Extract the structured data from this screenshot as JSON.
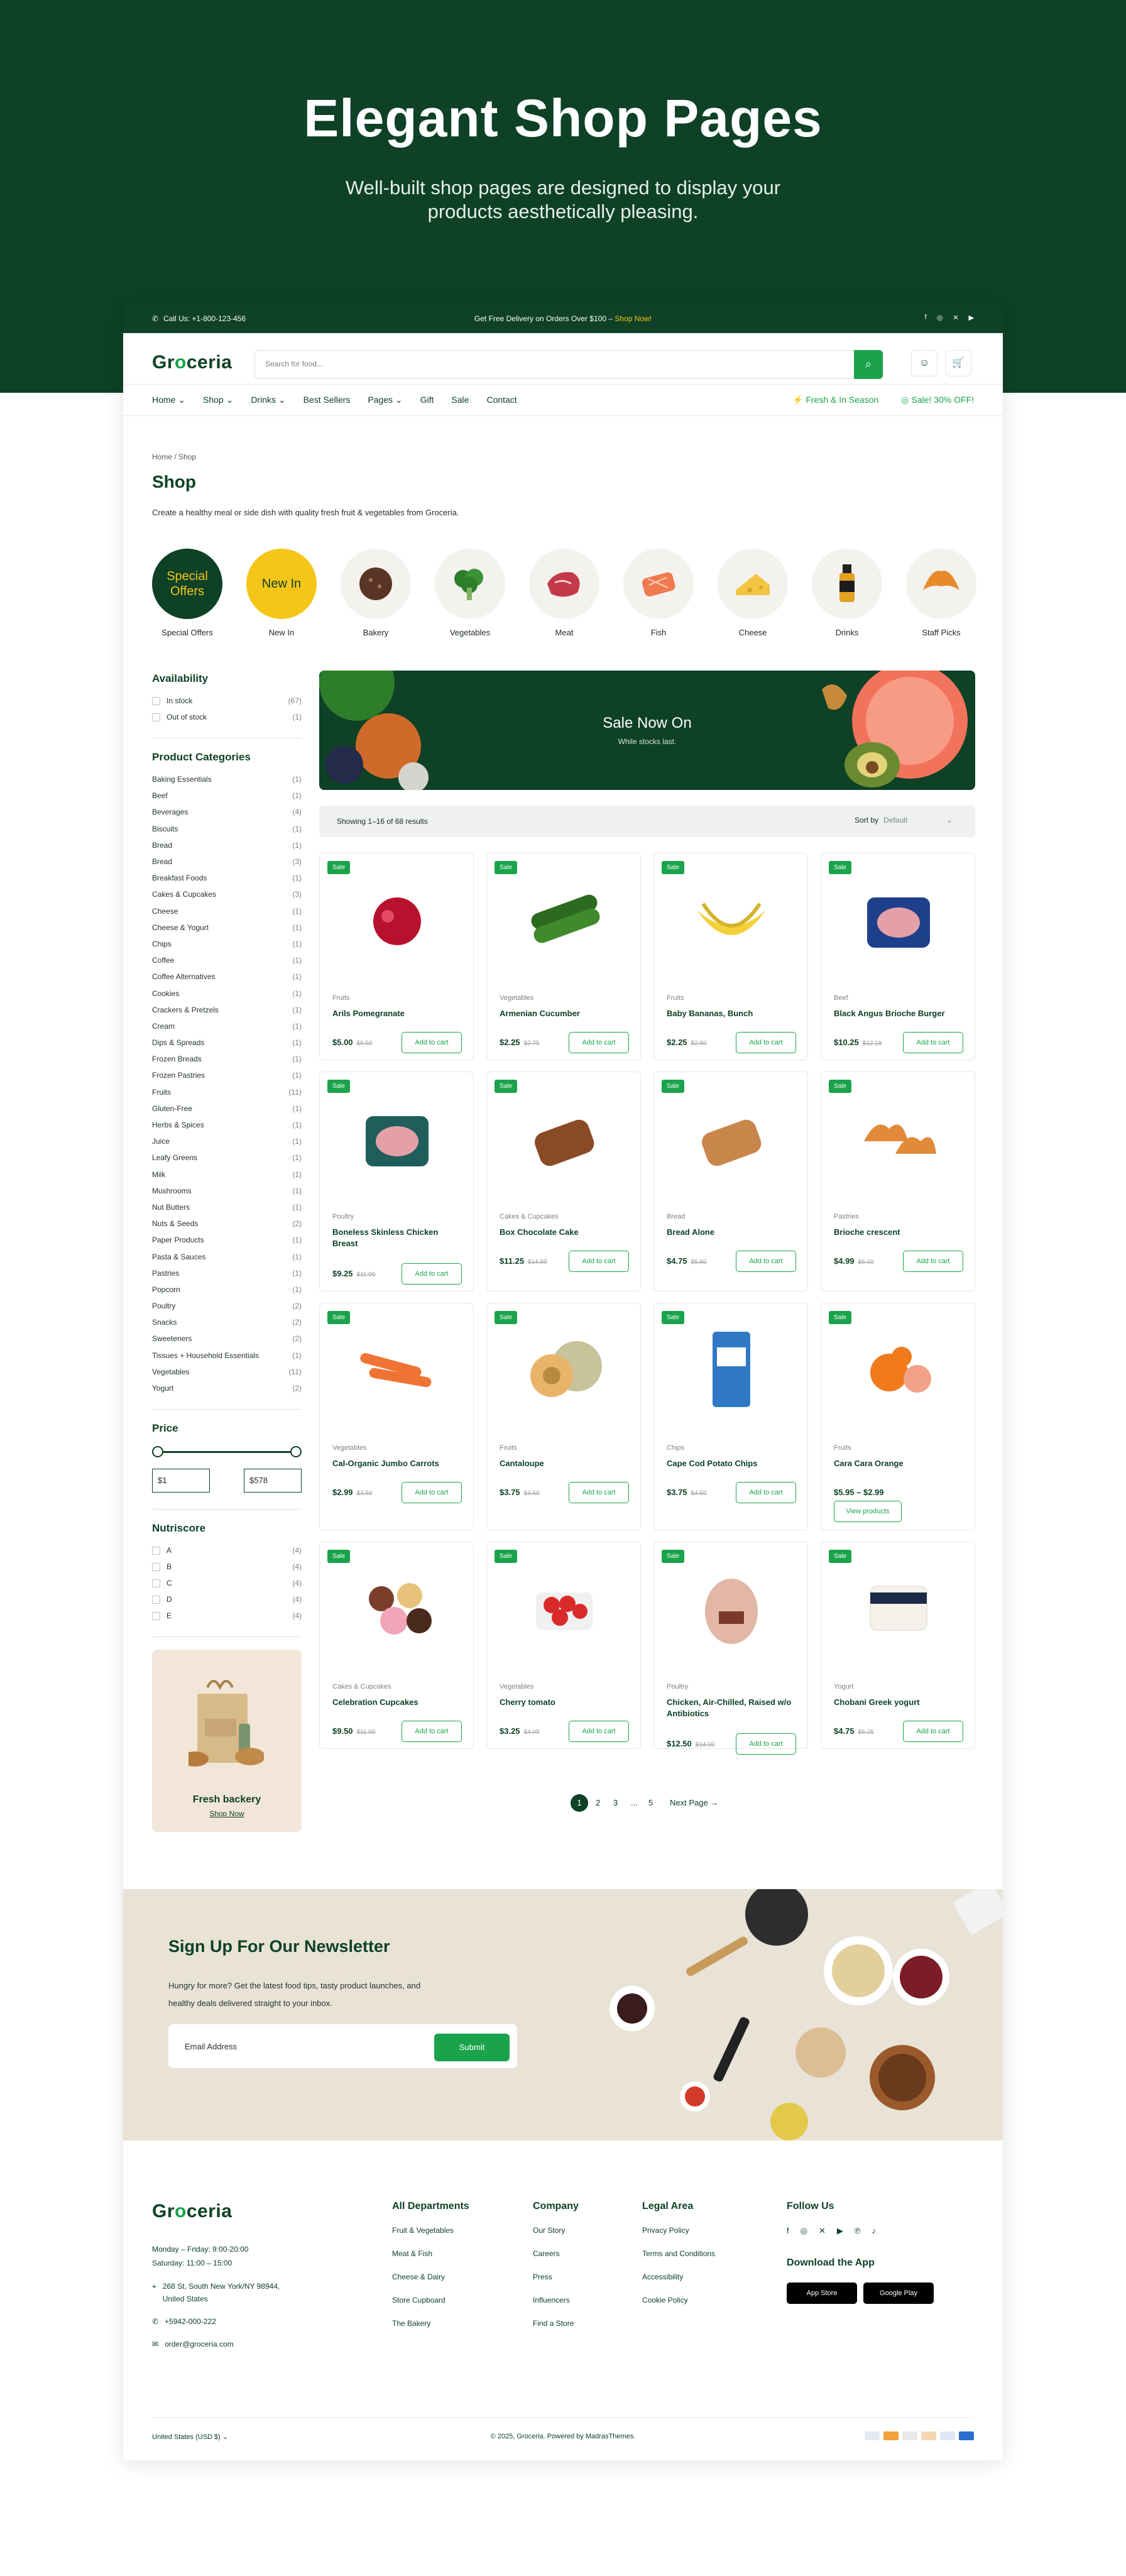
{
  "hero": {
    "title": "Elegant Shop Pages",
    "subtitle": "Well-built shop pages are designed to display your products aesthetically pleasing."
  },
  "topbar": {
    "phone": "Call Us: +1-800-123-456",
    "promo": "Get Free Delivery on Orders Over $100 – ",
    "promo_link": "Shop Now!",
    "socials": [
      "facebook-icon",
      "instagram-icon",
      "x-icon",
      "youtube-icon"
    ]
  },
  "header": {
    "logo_a": "Gr",
    "logo_b": "o",
    "logo_c": "ceria",
    "search_placeholder": "Search for food..."
  },
  "nav": {
    "items": [
      "Home",
      "Shop",
      "Drinks",
      "Best Sellers",
      "Pages",
      "Gift",
      "Sale",
      "Contact"
    ],
    "right1": "Fresh & In Season",
    "right2": "Sale! 30% OFF!"
  },
  "breadcrumb": "Home / Shop",
  "page_title": "Shop",
  "page_desc": "Create a healthy meal or side dish with quality fresh fruit & vegetables from Groceria.",
  "categories": [
    "Special Offers",
    "New In",
    "Bakery",
    "Vegetables",
    "Meat",
    "Fish",
    "Cheese",
    "Drinks",
    "Staff Picks"
  ],
  "category_badges": {
    "special": "Special Offers",
    "new": "New In"
  },
  "availability": {
    "title": "Availability",
    "items": [
      {
        "label": "In stock",
        "count": "(67)"
      },
      {
        "label": "Out of stock",
        "count": "(1)"
      }
    ]
  },
  "product_categories": {
    "title": "Product Categories",
    "items": [
      {
        "label": "Baking Essentials",
        "count": "(1)"
      },
      {
        "label": "Beef",
        "count": "(1)"
      },
      {
        "label": "Beverages",
        "count": "(4)"
      },
      {
        "label": "Biscuits",
        "count": "(1)"
      },
      {
        "label": "Bread",
        "count": "(1)"
      },
      {
        "label": "Bread",
        "count": "(3)"
      },
      {
        "label": "Breakfast Foods",
        "count": "(1)"
      },
      {
        "label": "Cakes & Cupcakes",
        "count": "(3)"
      },
      {
        "label": "Cheese",
        "count": "(1)"
      },
      {
        "label": "Cheese & Yogurt",
        "count": "(1)"
      },
      {
        "label": "Chips",
        "count": "(1)"
      },
      {
        "label": "Coffee",
        "count": "(1)"
      },
      {
        "label": "Coffee Alternatives",
        "count": "(1)"
      },
      {
        "label": "Cookies",
        "count": "(1)"
      },
      {
        "label": "Crackers & Pretzels",
        "count": "(1)"
      },
      {
        "label": "Cream",
        "count": "(1)"
      },
      {
        "label": "Dips & Spreads",
        "count": "(1)"
      },
      {
        "label": "Frozen Breads",
        "count": "(1)"
      },
      {
        "label": "Frozen Pastries",
        "count": "(1)"
      },
      {
        "label": "Fruits",
        "count": "(11)"
      },
      {
        "label": "Gluten-Free",
        "count": "(1)"
      },
      {
        "label": "Herbs & Spices",
        "count": "(1)"
      },
      {
        "label": "Juice",
        "count": "(1)"
      },
      {
        "label": "Leafy Greens",
        "count": "(1)"
      },
      {
        "label": "Milk",
        "count": "(1)"
      },
      {
        "label": "Mushrooms",
        "count": "(1)"
      },
      {
        "label": "Nut Butters",
        "count": "(1)"
      },
      {
        "label": "Nuts & Seeds",
        "count": "(2)"
      },
      {
        "label": "Paper Products",
        "count": "(1)"
      },
      {
        "label": "Pasta & Sauces",
        "count": "(1)"
      },
      {
        "label": "Pastries",
        "count": "(1)"
      },
      {
        "label": "Popcorn",
        "count": "(1)"
      },
      {
        "label": "Poultry",
        "count": "(2)"
      },
      {
        "label": "Snacks",
        "count": "(2)"
      },
      {
        "label": "Sweeteners",
        "count": "(2)"
      },
      {
        "label": "Tissues + Household Essentials",
        "count": "(1)"
      },
      {
        "label": "Vegetables",
        "count": "(11)"
      },
      {
        "label": "Yogurt",
        "count": "(2)"
      }
    ]
  },
  "price": {
    "title": "Price",
    "min": "$1",
    "max": "$578"
  },
  "nutriscore": {
    "title": "Nutriscore",
    "items": [
      {
        "label": "A",
        "count": "(4)"
      },
      {
        "label": "B",
        "count": "(4)"
      },
      {
        "label": "C",
        "count": "(4)"
      },
      {
        "label": "D",
        "count": "(4)"
      },
      {
        "label": "E",
        "count": "(4)"
      }
    ]
  },
  "promo": {
    "title": "Fresh backery",
    "link": "Shop Now"
  },
  "banner": {
    "title": "Sale Now On",
    "subtitle": "While stocks last."
  },
  "sort": {
    "showing": "Showing 1–16 of 68 results",
    "label": "Sort by",
    "value": "Default"
  },
  "products": [
    {
      "cat": "Fruits",
      "name": "Arils Pomegranate",
      "price": "$5.00",
      "old": "$6.50",
      "btn": "Add to cart",
      "color": "#b8112e"
    },
    {
      "cat": "Vegetables",
      "name": "Armenian Cucumber",
      "price": "$2.25",
      "old": "$2.75",
      "btn": "Add to cart",
      "color": "#2d6a1f"
    },
    {
      "cat": "Fruits",
      "name": "Baby Bananas, Bunch",
      "price": "$2.25",
      "old": "$2.50",
      "btn": "Add to cart",
      "color": "#f3d13b"
    },
    {
      "cat": "Beef",
      "name": "Black Angus Brioche Burger",
      "price": "$10.25",
      "old": "$12.18",
      "btn": "Add to cart",
      "color": "#1e3f8a"
    },
    {
      "cat": "Poultry",
      "name": "Boneless Skinless Chicken Breast",
      "price": "$9.25",
      "old": "$11.00",
      "btn": "Add to cart",
      "color": "#1f5e5a"
    },
    {
      "cat": "Cakes & Cupcakes",
      "name": "Box Chocolate Cake",
      "price": "$11.25",
      "old": "$14.50",
      "btn": "Add to cart",
      "color": "#8a4a25"
    },
    {
      "cat": "Bread",
      "name": "Bread Alone",
      "price": "$4.75",
      "old": "$5.50",
      "btn": "Add to cart",
      "color": "#c9864a"
    },
    {
      "cat": "Pastries",
      "name": "Brioche crescent",
      "price": "$4.99",
      "old": "$6.00",
      "btn": "Add to cart",
      "color": "#e08a3a"
    },
    {
      "cat": "Vegetables",
      "name": "Cal-Organic Jumbo Carrots",
      "price": "$2.99",
      "old": "$3.50",
      "btn": "Add to cart",
      "color": "#ef7433"
    },
    {
      "cat": "Fruits",
      "name": "Cantaloupe",
      "price": "$3.75",
      "old": "$4.50",
      "btn": "Add to cart",
      "color": "#e8b46a"
    },
    {
      "cat": "Chips",
      "name": "Cape Cod Potato Chips",
      "price": "$3.75",
      "old": "$4.50",
      "btn": "Add to cart",
      "color": "#2f78c4"
    },
    {
      "cat": "Fruits",
      "name": "Cara Cara Orange",
      "price": "$5.95 – $2.99",
      "old": "",
      "btn": "View products",
      "color": "#f07a1c"
    },
    {
      "cat": "Cakes & Cupcakes",
      "name": "Celebration Cupcakes",
      "price": "$9.50",
      "old": "$11.00",
      "btn": "Add to cart",
      "color": "#7a3f2a"
    },
    {
      "cat": "Vegetables",
      "name": "Cherry tomato",
      "price": "$3.25",
      "old": "$4.00",
      "btn": "Add to cart",
      "color": "#d92a2a"
    },
    {
      "cat": "Poultry",
      "name": "Chicken, Air-Chilled, Raised w/o Antibiotics",
      "price": "$12.50",
      "old": "$14.00",
      "btn": "Add to cart",
      "color": "#e2b7a6"
    },
    {
      "cat": "Yogurt",
      "name": "Chobani Greek yogurt",
      "price": "$4.75",
      "old": "$6.25",
      "btn": "Add to cart",
      "color": "#f3f1ea"
    }
  ],
  "sale_badge": "Sale",
  "pagination": {
    "pages": [
      "1",
      "2",
      "3",
      "...",
      "5"
    ],
    "next": "Next Page"
  },
  "newsletter": {
    "title": "Sign Up For Our Newsletter",
    "text": "Hungry for more? Get the latest food tips, tasty product launches, and healthy deals delivered straight to your inbox.",
    "placeholder": "Email Address",
    "button": "Submit"
  },
  "footer": {
    "hours1": "Monday – Friday: 9:00-20:00",
    "hours2": "Saturday: 11:00 – 15:00",
    "address": "268 St, South New York/NY 98944, United States",
    "phone": "+5942-000-222",
    "email": "order@groceria.com",
    "departments": {
      "title": "All Departments",
      "items": [
        "Fruit & Vegetables",
        "Meat & Fish",
        "Cheese & Dairy",
        "Store Cupboard",
        "The Bakery"
      ]
    },
    "company": {
      "title": "Company",
      "items": [
        "Our Story",
        "Careers",
        "Press",
        "Influencers",
        "Find a Store"
      ]
    },
    "legal": {
      "title": "Legal Area",
      "items": [
        "Privacy Policy",
        "Terms and Conditions",
        "Accessibility",
        "Cookie Policy"
      ]
    },
    "follow": "Follow Us",
    "download": "Download the App",
    "appstore": "App Store",
    "googleplay": "Google Play",
    "locale": "United States (USD $)",
    "copyright": "© 2025, Groceria. Powered by MadrasThemes."
  }
}
